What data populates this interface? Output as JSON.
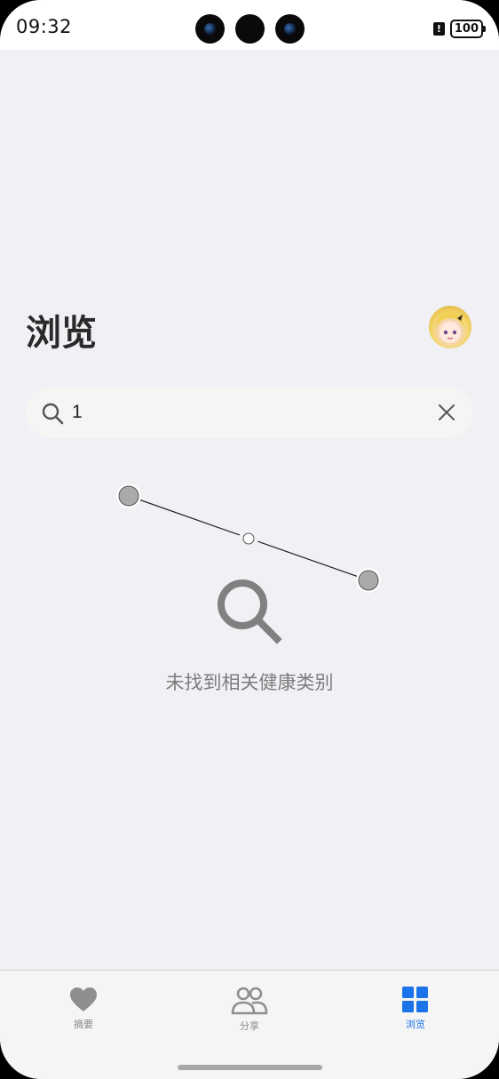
{
  "status_bar": {
    "time": "09:32",
    "battery": "100",
    "alert": "!"
  },
  "header": {
    "title": "浏览",
    "avatar_icon": "user-avatar"
  },
  "search": {
    "value": "1",
    "placeholder": "",
    "search_icon": "search-icon",
    "clear_icon": "close-icon"
  },
  "empty_state": {
    "icon": "search-icon",
    "message": "未找到相关健康类别"
  },
  "tabs": [
    {
      "label": "摘要",
      "icon": "heart-icon",
      "active": false
    },
    {
      "label": "分享",
      "icon": "people-icon",
      "active": false
    },
    {
      "label": "浏览",
      "icon": "grid-icon",
      "active": true
    }
  ],
  "colors": {
    "background": "#f0f0f5",
    "accent": "#1a73e8",
    "inactive": "#8a8a8a"
  }
}
